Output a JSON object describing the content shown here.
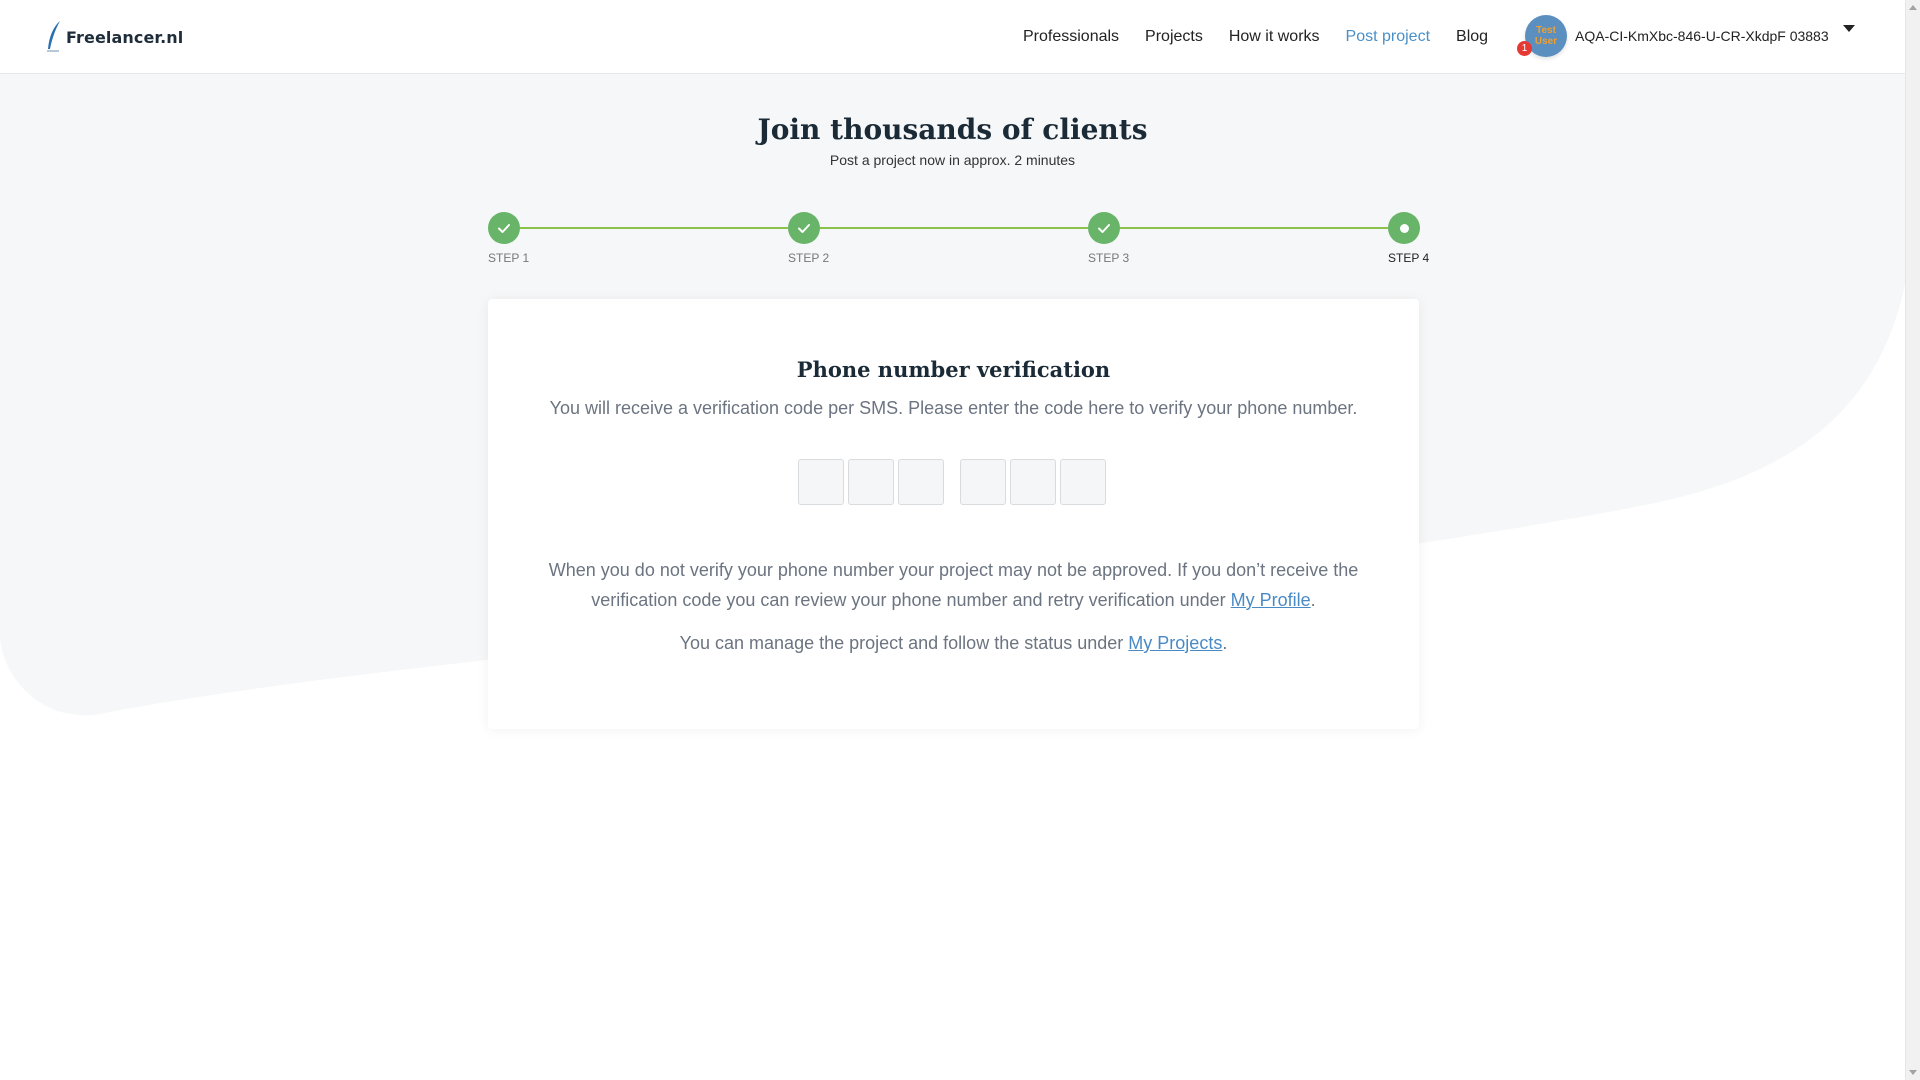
{
  "header": {
    "logo_text": "Freelancer.nl",
    "nav": [
      {
        "label": "Professionals",
        "active": false
      },
      {
        "label": "Projects",
        "active": false
      },
      {
        "label": "How it works",
        "active": false
      },
      {
        "label": "Post project",
        "active": true
      },
      {
        "label": "Blog",
        "active": false
      }
    ],
    "user": {
      "avatar_text": "Test User",
      "notification_count": "1",
      "name": "AQA-CI-KmXbc-846-U-CR-XkdpF 03883"
    }
  },
  "hero": {
    "title": "Join thousands of clients",
    "subtitle": "Post a project now in approx. 2 minutes"
  },
  "steps": [
    {
      "label": "STEP 1",
      "state": "done"
    },
    {
      "label": "STEP 2",
      "state": "done"
    },
    {
      "label": "STEP 3",
      "state": "done"
    },
    {
      "label": "STEP 4",
      "state": "current"
    }
  ],
  "verification": {
    "title": "Phone number verification",
    "instruction": "You will receive a verification code per SMS. Please enter the code here to verify your phone number.",
    "code_values": [
      "",
      "",
      "",
      "",
      "",
      ""
    ],
    "info_text": "When you do not verify your phone number your project may not be approved. If you don’t receive the verification code you can review your phone number and retry verification under",
    "info_link": "My Profile",
    "info_end": ".",
    "manage_text": "You can manage the project and follow the status under",
    "manage_link": "My Projects",
    "manage_end": "."
  },
  "colors": {
    "accent": "#4a90c8",
    "step_done": "#68b468",
    "step_line": "#8bc34a",
    "badge": "#e53935"
  }
}
